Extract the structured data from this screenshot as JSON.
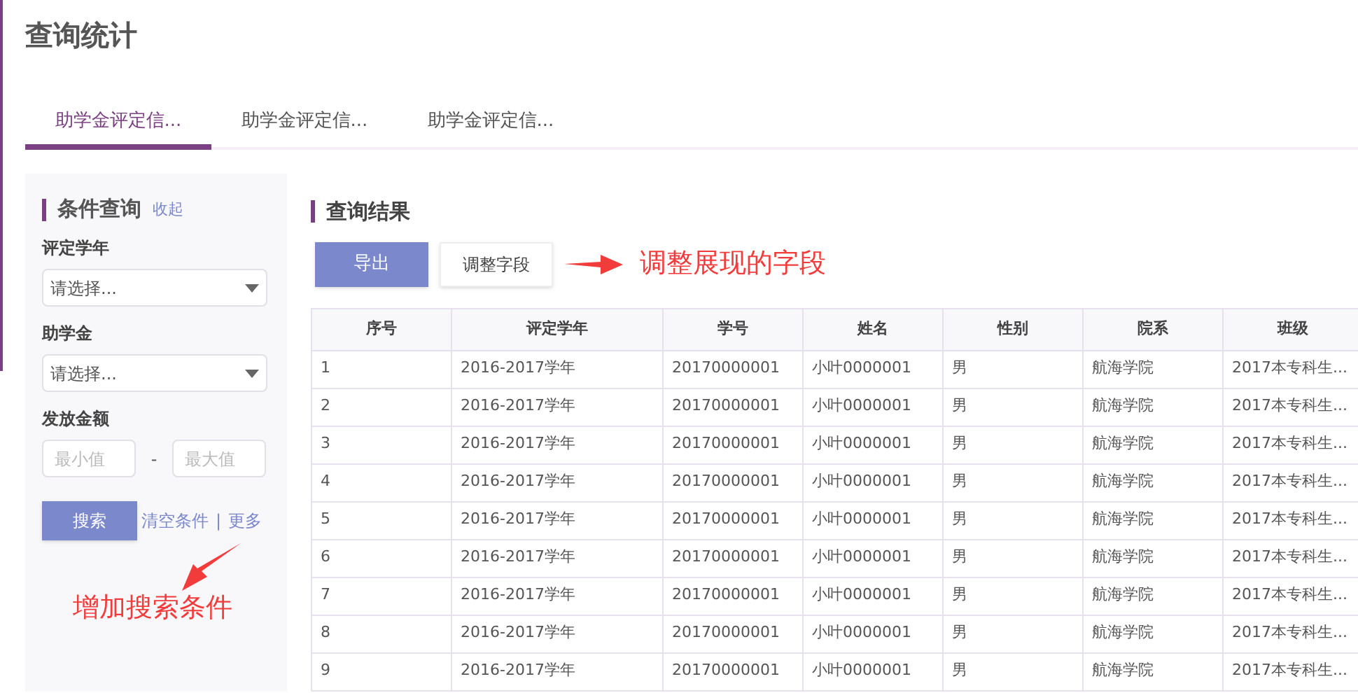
{
  "page_title": "查询统计",
  "tabs": [
    {
      "label": "助学金评定信...",
      "selected": true
    },
    {
      "label": "助学金评定信...",
      "selected": false
    },
    {
      "label": "助学金评定信...",
      "selected": false
    }
  ],
  "filter_panel": {
    "title": "条件查询",
    "collapse_link": "收起",
    "fields": [
      {
        "kind": "select",
        "label": "评定学年",
        "placeholder": "请选择..."
      },
      {
        "kind": "select",
        "label": "助学金",
        "placeholder": "请选择..."
      },
      {
        "kind": "range",
        "label": "发放金额",
        "min_placeholder": "最小值",
        "separator": "-",
        "max_placeholder": "最大值"
      }
    ],
    "search_button": "搜索",
    "clear_link": "清空条件",
    "divider": "|",
    "more_link": "更多"
  },
  "results": {
    "title": "查询结果",
    "export_button": "导出",
    "adjust_button": "调整字段",
    "table": {
      "columns": [
        "序号",
        "评定学年",
        "学号",
        "姓名",
        "性别",
        "院系",
        "班级"
      ],
      "rows": [
        [
          "1",
          "2016-2017学年",
          "20170000001",
          "小叶0000001",
          "男",
          "航海学院",
          "2017本专科生..."
        ],
        [
          "2",
          "2016-2017学年",
          "20170000001",
          "小叶0000001",
          "男",
          "航海学院",
          "2017本专科生..."
        ],
        [
          "3",
          "2016-2017学年",
          "20170000001",
          "小叶0000001",
          "男",
          "航海学院",
          "2017本专科生..."
        ],
        [
          "4",
          "2016-2017学年",
          "20170000001",
          "小叶0000001",
          "男",
          "航海学院",
          "2017本专科生..."
        ],
        [
          "5",
          "2016-2017学年",
          "20170000001",
          "小叶0000001",
          "男",
          "航海学院",
          "2017本专科生..."
        ],
        [
          "6",
          "2016-2017学年",
          "20170000001",
          "小叶0000001",
          "男",
          "航海学院",
          "2017本专科生..."
        ],
        [
          "7",
          "2016-2017学年",
          "20170000001",
          "小叶0000001",
          "男",
          "航海学院",
          "2017本专科生..."
        ],
        [
          "8",
          "2016-2017学年",
          "20170000001",
          "小叶0000001",
          "男",
          "航海学院",
          "2017本专科生..."
        ],
        [
          "9",
          "2016-2017学年",
          "20170000001",
          "小叶0000001",
          "男",
          "航海学院",
          "2017本专科生..."
        ]
      ]
    }
  },
  "annotations": [
    {
      "kind": "right",
      "text": "调整展现的字段"
    },
    {
      "kind": "up",
      "text": "增加搜索条件"
    }
  ]
}
